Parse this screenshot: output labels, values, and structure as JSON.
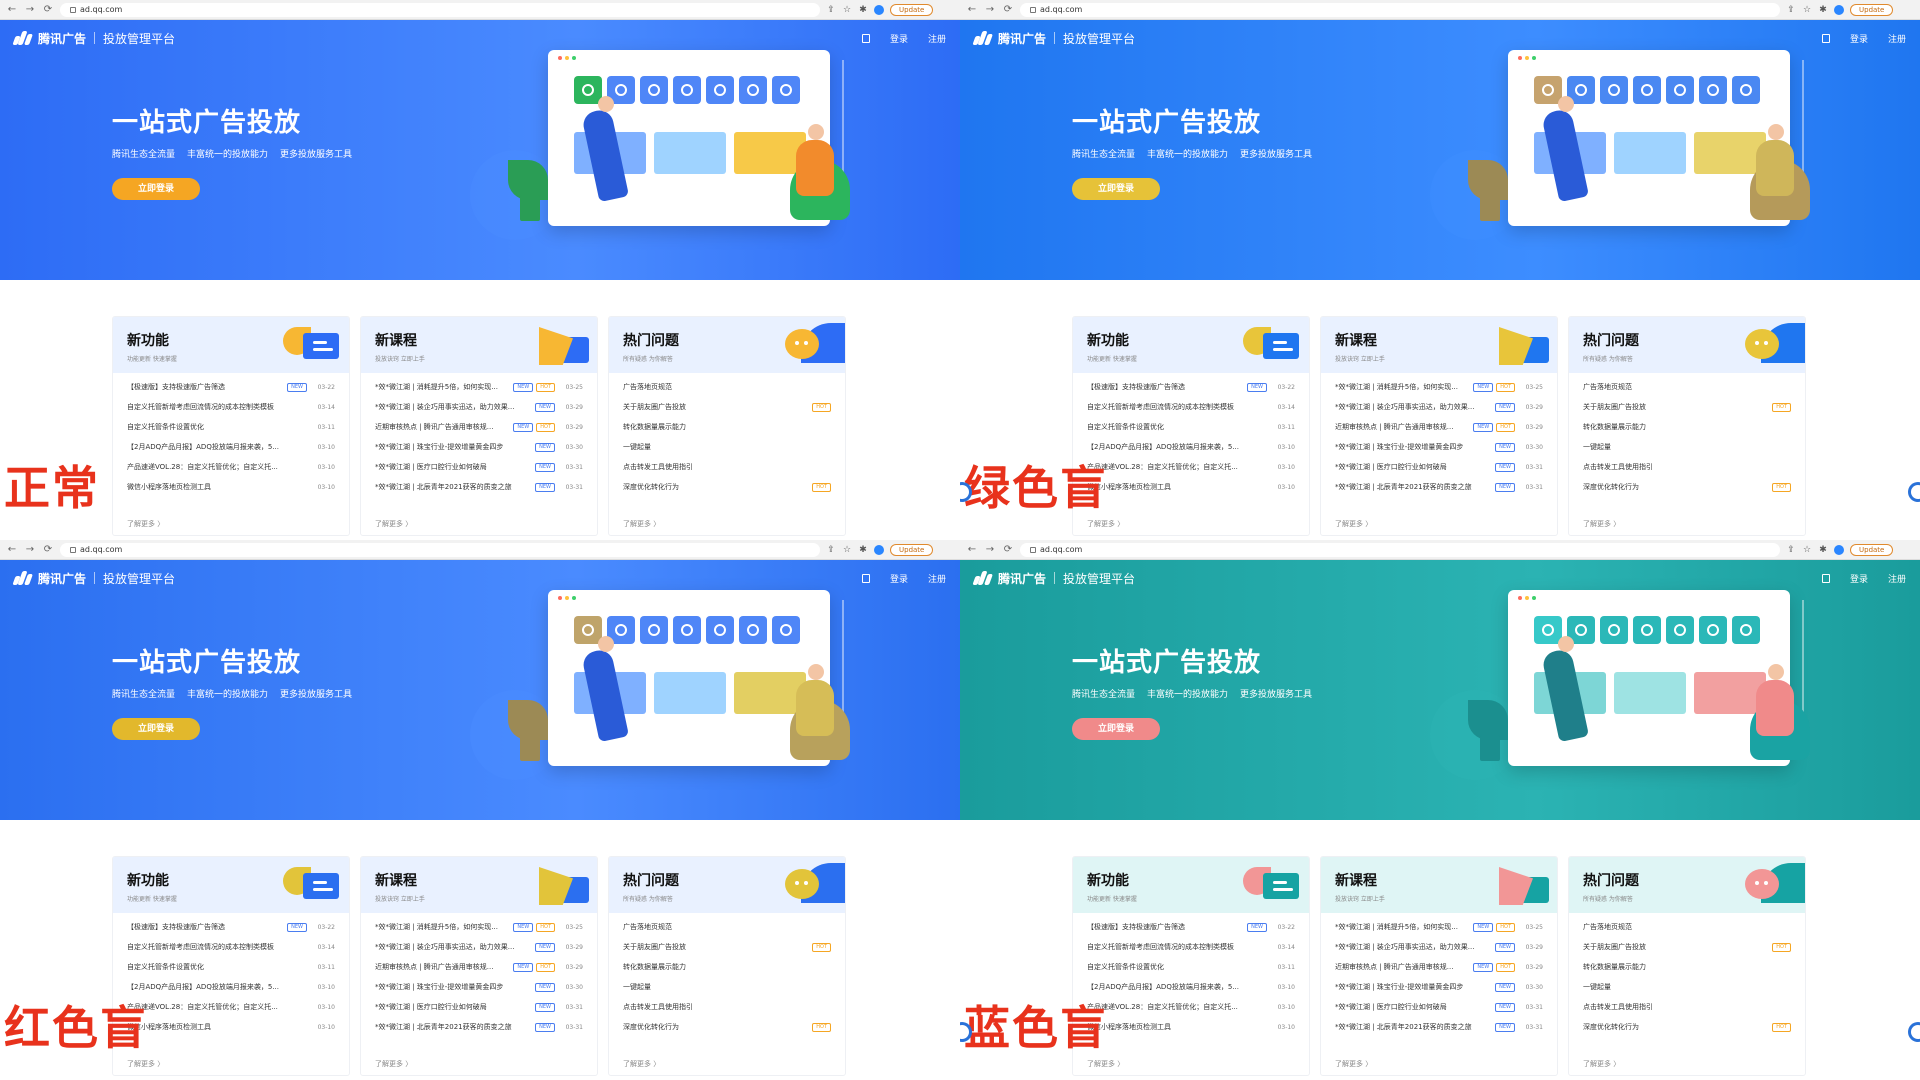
{
  "browser": {
    "url": "ad.qq.com",
    "update_label": "Update"
  },
  "site": {
    "brand": "腾讯广告",
    "platform": "投放管理平台",
    "login": "登录",
    "register": "注册",
    "hero_title": "一站式广告投放",
    "hero_subs": [
      "腾讯生态全流量",
      "丰富统一的投放能力",
      "更多投放服务工具"
    ],
    "cta": "立即登录",
    "more": "了解更多 〉"
  },
  "cards": [
    {
      "title": "新功能",
      "subtitle": "功能更新 快速掌握",
      "rows": [
        {
          "text": "【极速版】支持极速版广告筛选",
          "tag": "NEW",
          "date": "03-22"
        },
        {
          "text": "自定义托管新增考虑回流情况的成本控制类模板",
          "tag": "",
          "date": "03-14"
        },
        {
          "text": "自定义托管条件设置优化",
          "tag": "",
          "date": "03-11"
        },
        {
          "text": "【2月ADQ产品月报】ADQ投放端月报来袭，5...",
          "tag": "",
          "date": "03-10"
        },
        {
          "text": "产品速递VOL.28：自定义托管优化；自定义托...",
          "tag": "",
          "date": "03-10"
        },
        {
          "text": "微信小程序落地页检测工具",
          "tag": "",
          "date": "03-10"
        }
      ]
    },
    {
      "title": "新课程",
      "subtitle": "投放诀窍 立即上手",
      "rows": [
        {
          "text": "*效*微江湖 | 消耗提升5倍，如何实现...",
          "tag": "NEW",
          "tag2": "HOT",
          "date": "03-25"
        },
        {
          "text": "*效*微江湖 | 装企巧用事实迅达，助力效果...",
          "tag": "NEW",
          "date": "03-29"
        },
        {
          "text": "近期审核热点 | 腾讯广告通用审核规...",
          "tag": "NEW",
          "tag2": "HOT",
          "date": "03-29"
        },
        {
          "text": "*效*微江湖 | 珠宝行业-提效增量黄金四步",
          "tag": "NEW",
          "date": "03-30"
        },
        {
          "text": "*效*微江湖 | 医疗口腔行业如何破局",
          "tag": "NEW",
          "date": "03-31"
        },
        {
          "text": "*效*微江湖 | 北辰青年2021获客的质变之旅",
          "tag": "NEW",
          "date": "03-31"
        }
      ]
    },
    {
      "title": "热门问题",
      "subtitle": "所有疑惑 为你解答",
      "rows": [
        {
          "text": "广告落地页规范",
          "tag": "",
          "date": ""
        },
        {
          "text": "关于朋友圈广告投放",
          "tag": "HOT",
          "date": ""
        },
        {
          "text": "转化数据量展示能力",
          "tag": "",
          "date": ""
        },
        {
          "text": "一键起量",
          "tag": "",
          "date": ""
        },
        {
          "text": "点击转发工具使用指引",
          "tag": "",
          "date": ""
        },
        {
          "text": "深度优化转化行为",
          "tag": "HOT",
          "date": ""
        }
      ]
    }
  ],
  "variants": [
    {
      "label": "正常",
      "hero": "#2d6cf5",
      "hero2": "#4a8bff",
      "accent": "#f5a623",
      "tile": "#4f86f7",
      "tile_hi": "#2cb55d",
      "panel1": "#7fb0ff",
      "panel2": "#9fd3ff",
      "panel3": "#f7c948",
      "card_head": "#e9f1ff",
      "ill": "#2d6cf5",
      "ill2": "#f7b733",
      "person": "#2a5bd7",
      "chair": "#2cb55d",
      "person2": "#f28b2c",
      "plant": "#2a9d55"
    },
    {
      "label": "绿色盲",
      "hero": "#1f76f0",
      "hero2": "#3d8dff",
      "accent": "#e6c238",
      "tile": "#4a88f2",
      "tile_hi": "#c6a36e",
      "panel1": "#7fb0ff",
      "panel2": "#9fd3ff",
      "panel3": "#e8d36a",
      "card_head": "#e9f1ff",
      "ill": "#1f76f0",
      "ill2": "#e8c53a",
      "person": "#2a5bd7",
      "chair": "#b59a5a",
      "person2": "#cfb65a",
      "plant": "#9c8a55"
    },
    {
      "label": "红色盲",
      "hero": "#2b6ff0",
      "hero2": "#4a8bff",
      "accent": "#e2b82c",
      "tile": "#4f86f7",
      "tile_hi": "#bfa46a",
      "panel1": "#7fb0ff",
      "panel2": "#9fd3ff",
      "panel3": "#e3cf62",
      "card_head": "#e9f1ff",
      "ill": "#2b6ff0",
      "ill2": "#e2c43a",
      "person": "#2a5bd7",
      "chair": "#b8a15c",
      "person2": "#d6bd57",
      "plant": "#9c8a55"
    },
    {
      "label": "蓝色盲",
      "hero": "#1a9c9c",
      "hero2": "#2bb3b3",
      "accent": "#f08a8a",
      "tile": "#2bb8b8",
      "tile_hi": "#36c9c9",
      "panel1": "#7dd6d6",
      "panel2": "#9ee3e3",
      "panel3": "#f2a0a0",
      "card_head": "#dff5f5",
      "ill": "#16a3a3",
      "ill2": "#f29696",
      "person": "#1f7f8a",
      "chair": "#1aa3a3",
      "person2": "#f08a8a",
      "plant": "#1b8f8f"
    }
  ]
}
